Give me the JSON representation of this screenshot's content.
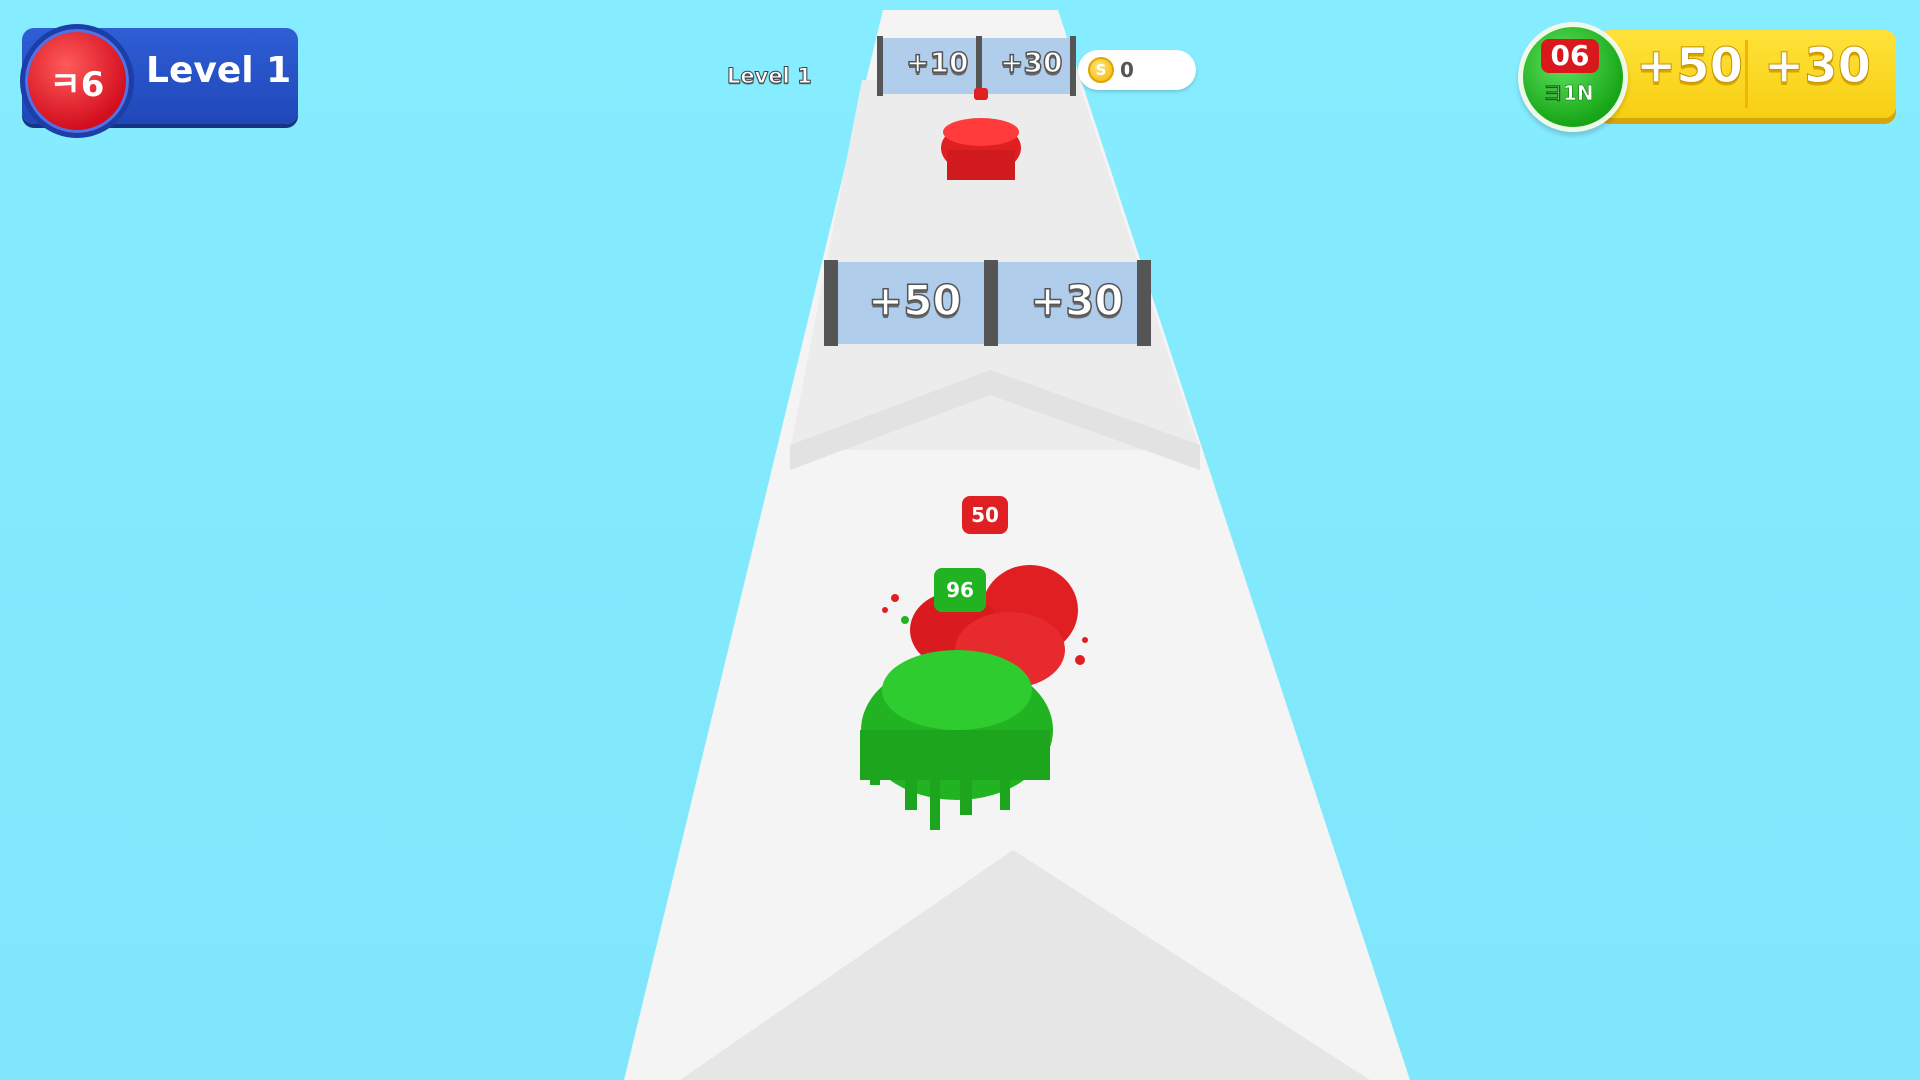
{
  "hud": {
    "level_badge": {
      "count": "ㅋ6",
      "label": "Level 1"
    },
    "mini_level_label": "Level 1",
    "coins": "0",
    "score_panel": {
      "circle_value": "06",
      "circle_sub": "ヨ1N",
      "left": "+50",
      "right": "+30"
    }
  },
  "gates": {
    "far": {
      "left": "+10",
      "right": "+30"
    },
    "near": {
      "left": "+50",
      "right": "+30"
    }
  },
  "crowds": {
    "enemy_far_count": "",
    "enemy_near_count": "50",
    "player_count": "96"
  },
  "colors": {
    "sky": "#86ecff",
    "track": "#f5f5f5",
    "player": "#22b322",
    "enemy": "#e01f22",
    "accent_blue": "#2f5ed6",
    "accent_yellow": "#ffe23a"
  },
  "icons": [
    "coin-icon"
  ]
}
